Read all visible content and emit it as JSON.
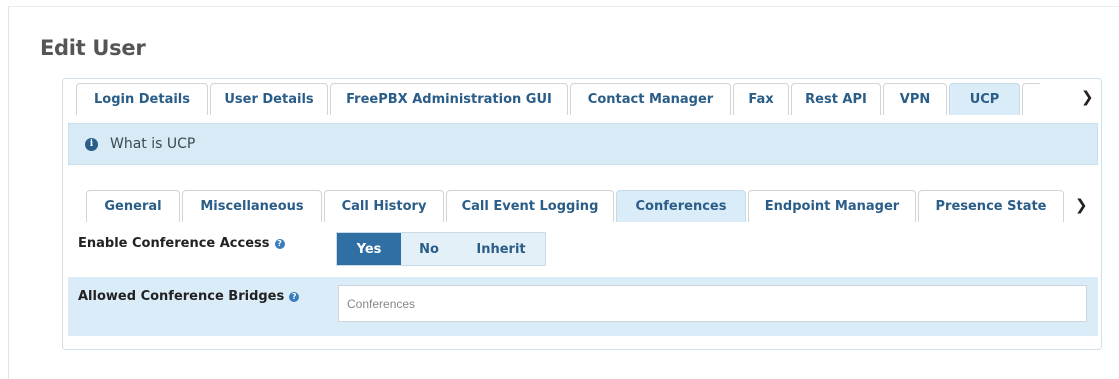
{
  "page": {
    "title": "Edit User"
  },
  "top_tabs": [
    {
      "label": "Login Details",
      "active": false
    },
    {
      "label": "User Details",
      "active": false
    },
    {
      "label": "FreePBX Administration GUI",
      "active": false
    },
    {
      "label": "Contact Manager",
      "active": false
    },
    {
      "label": "Fax",
      "active": false
    },
    {
      "label": "Rest API",
      "active": false
    },
    {
      "label": "VPN",
      "active": false
    },
    {
      "label": "UCP",
      "active": true
    }
  ],
  "info_bar": {
    "text": "What is UCP",
    "icon": "info-circle-icon"
  },
  "sub_tabs": [
    {
      "label": "General",
      "active": false
    },
    {
      "label": "Miscellaneous",
      "active": false
    },
    {
      "label": "Call History",
      "active": false
    },
    {
      "label": "Call Event Logging",
      "active": false
    },
    {
      "label": "Conferences",
      "active": true
    },
    {
      "label": "Endpoint Manager",
      "active": false
    },
    {
      "label": "Presence State",
      "active": false
    }
  ],
  "fields": {
    "enable_conference_access": {
      "label": "Enable Conference Access",
      "options": [
        "Yes",
        "No",
        "Inherit"
      ],
      "selected": "Yes"
    },
    "allowed_conference_bridges": {
      "label": "Allowed Conference Bridges",
      "value": "",
      "placeholder": "Conferences"
    }
  },
  "colors": {
    "accent": "#2f6fa3",
    "tab_text": "#2a5d88",
    "active_tab_bg": "#d9ecf7",
    "info_bg": "#d7eaf5"
  }
}
